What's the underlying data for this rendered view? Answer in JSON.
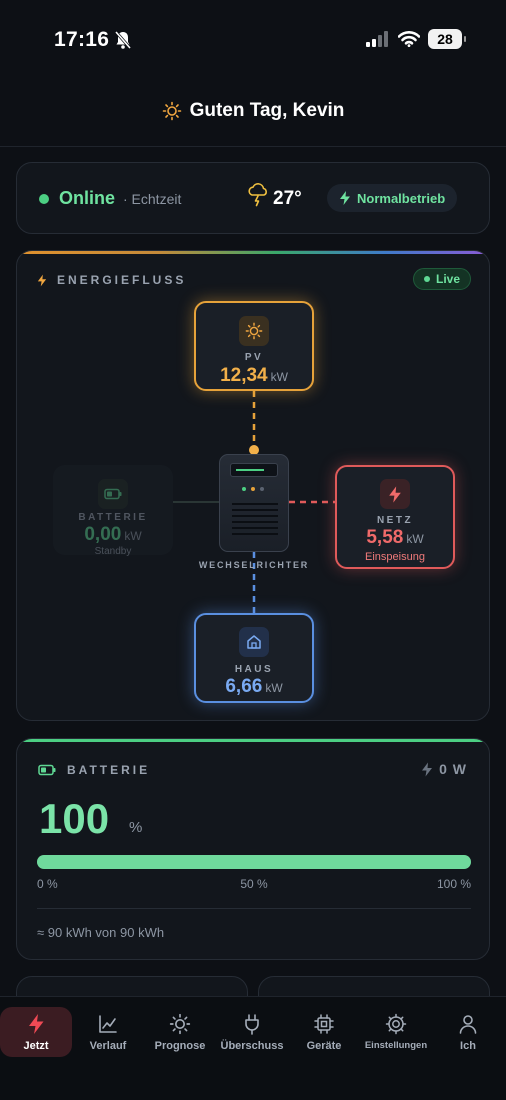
{
  "status_bar": {
    "time": "17:16",
    "battery": "28"
  },
  "header": {
    "greeting": "Guten Tag, Kevin"
  },
  "status": {
    "online": "Online",
    "realtime": "· Echtzeit",
    "temperature": "27°",
    "mode": "Normalbetrieb"
  },
  "energy_flow": {
    "title": "ENERGIEFLUSS",
    "live": "Live",
    "pv": {
      "label": "PV",
      "value": "12,34",
      "unit": "kW"
    },
    "battery": {
      "label": "BATTERIE",
      "value": "0,00",
      "unit": "kW",
      "status": "Standby"
    },
    "grid": {
      "label": "NETZ",
      "value": "5,58",
      "unit": "kW",
      "status": "Einspeisung"
    },
    "house": {
      "label": "HAUS",
      "value": "6,66",
      "unit": "kW"
    },
    "inverter": {
      "label": "WECHSELRICHTER"
    }
  },
  "battery_card": {
    "title": "BATTERIE",
    "power": "0 W",
    "percent": "100",
    "percent_unit": "%",
    "charge_fraction": 1.0,
    "scale": [
      "0 %",
      "50 %",
      "100 %"
    ],
    "capacity": "≈ 90 kWh von 90 kWh"
  },
  "tabs": [
    {
      "label": "Jetzt",
      "icon": "bolt-icon",
      "active": true
    },
    {
      "label": "Verlauf",
      "icon": "chart-line-icon"
    },
    {
      "label": "Prognose",
      "icon": "sun-icon"
    },
    {
      "label": "Überschuss",
      "icon": "plug-icon"
    },
    {
      "label": "Geräte",
      "icon": "chip-icon"
    },
    {
      "label": "Einstellungen",
      "icon": "gear-icon"
    },
    {
      "label": "Ich",
      "icon": "person-icon"
    }
  ],
  "colors": {
    "pv": "#e6a23a",
    "grid": "#e05a5a",
    "house": "#5a8fe0",
    "battery": "#4ccf83",
    "accent": "#6fe3a0",
    "tab_active": "#3b1c22"
  }
}
